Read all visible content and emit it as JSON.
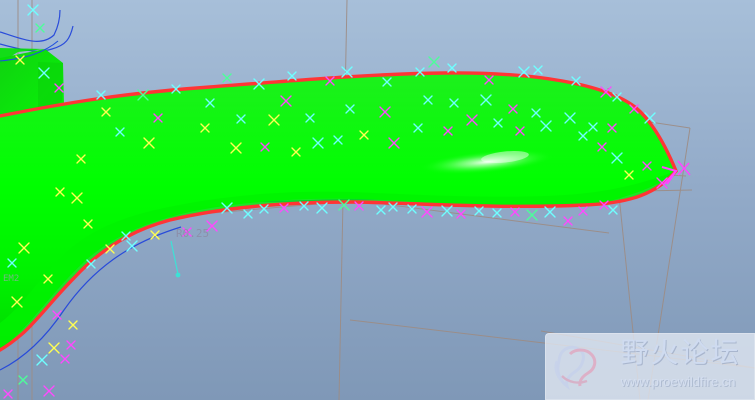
{
  "viewport": {
    "background_top": "#a7bfd9",
    "background_bottom": "#7f98b7",
    "surface_color": "#00ff00",
    "edge_color": "#ff2f2f",
    "marker_colors": [
      "#6fffff",
      "#ff49ff",
      "#ffff52",
      "#ffffff",
      "#4cff99"
    ]
  },
  "labels": {
    "dimension_label": "R0.25",
    "side_label": "EM2"
  },
  "watermark": {
    "title": "野火论坛",
    "url": "www.proewildfire.cn",
    "logo_icon": "flame-ribbon-icon"
  }
}
